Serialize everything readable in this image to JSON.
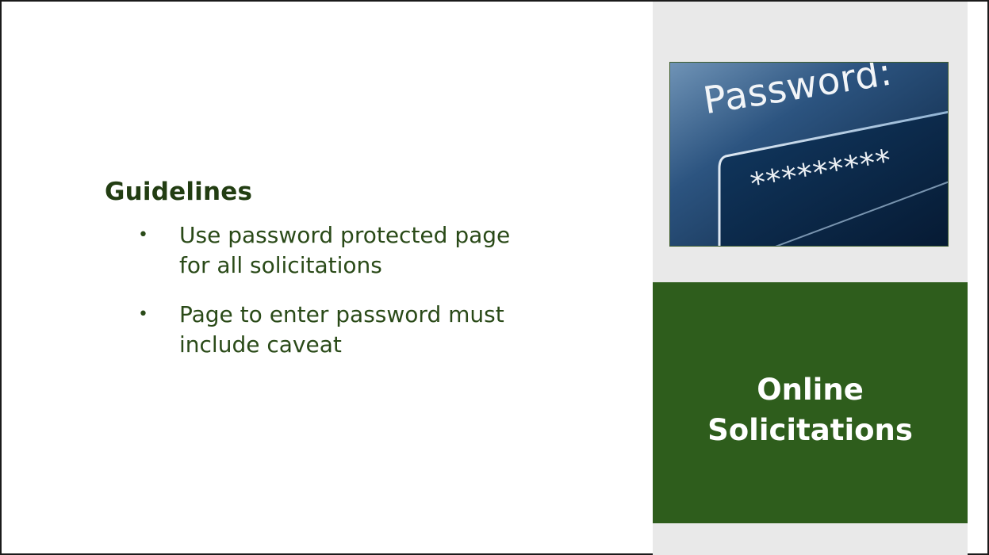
{
  "slide": {
    "heading": "Guidelines",
    "bullets": [
      "Use password protected page for all solicitations",
      "Page to enter password must include caveat"
    ],
    "bullet_glyph": "•",
    "photo": {
      "label": "Password:",
      "masked_value": "*********"
    },
    "title_lines": [
      "Online",
      "Solicitations"
    ]
  },
  "colors": {
    "heading": "#223d12",
    "title_box": "#2e5d1c",
    "side_panel": "#e9e9e9"
  }
}
